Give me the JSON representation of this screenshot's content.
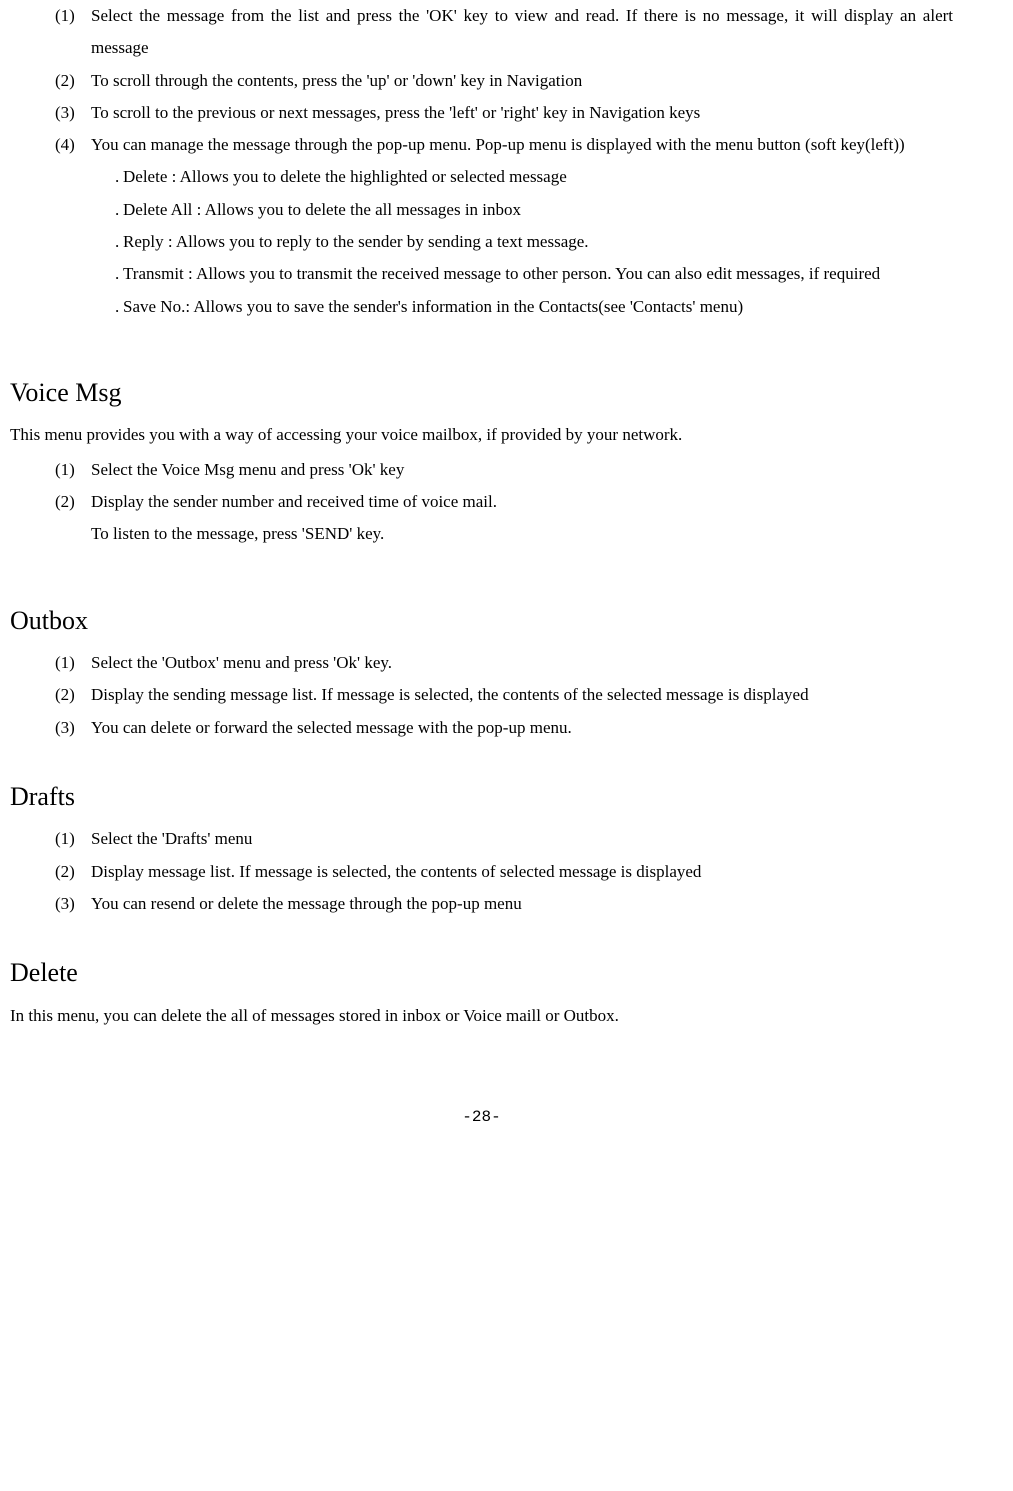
{
  "inbox": {
    "items": [
      {
        "num": "(1)",
        "text": "Select the message from the list and press the 'OK' key to view and read. If there is no message, it will display an alert message"
      },
      {
        "num": "(2)",
        "text": "To scroll through the contents, press the 'up' or 'down' key in Navigation"
      },
      {
        "num": "(3)",
        "text": "To scroll to the previous or next messages, press the 'left' or 'right' key in Navigation keys"
      },
      {
        "num": "(4)",
        "text": "You can manage the message through the pop-up menu. Pop-up menu is displayed with the menu button (soft key(left))"
      }
    ],
    "subitems": [
      {
        "dot": ".",
        "text": "Delete : Allows you to delete the highlighted or selected message"
      },
      {
        "dot": ".",
        "text": "Delete All : Allows you to delete the all messages in inbox"
      },
      {
        "dot": ".",
        "text": "Reply : Allows you to reply to the sender by sending a text message."
      },
      {
        "dot": ".",
        "text": "Transmit : Allows you to transmit the received message to other person. You can also edit messages, if required"
      },
      {
        "dot": ".",
        "text": "Save No.: Allows you to save the sender's information in the Contacts(see 'Contacts' menu)"
      }
    ]
  },
  "voice": {
    "heading": "Voice Msg",
    "intro": "This menu provides you with a way of accessing your voice mailbox, if provided by your network.",
    "items": [
      {
        "num": "(1)",
        "text": "Select the Voice Msg menu and press 'Ok' key"
      },
      {
        "num": "(2)",
        "text": "Display the sender number and received time of voice mail."
      }
    ],
    "extra": "To listen to the message, press 'SEND' key."
  },
  "outbox": {
    "heading": "Outbox",
    "items": [
      {
        "num": "(1)",
        "text": "Select the 'Outbox' menu and press 'Ok' key."
      },
      {
        "num": "(2)",
        "text": "Display the sending message list. If message is selected, the contents of the selected message is displayed"
      },
      {
        "num": "(3)",
        "text": "You can delete or forward the selected message with the pop-up menu."
      }
    ]
  },
  "drafts": {
    "heading": "Drafts",
    "items": [
      {
        "num": "(1)",
        "text": "Select the 'Drafts' menu"
      },
      {
        "num": "(2)",
        "text": "Display message list. If message is selected, the contents of selected message is displayed"
      },
      {
        "num": "(3)",
        "text": "You can resend or delete the message through the pop-up menu"
      }
    ]
  },
  "delete": {
    "heading": "Delete",
    "intro": "In this menu, you can delete the all of messages stored in inbox or Voice maill or Outbox."
  },
  "pageNumber": "-28-"
}
